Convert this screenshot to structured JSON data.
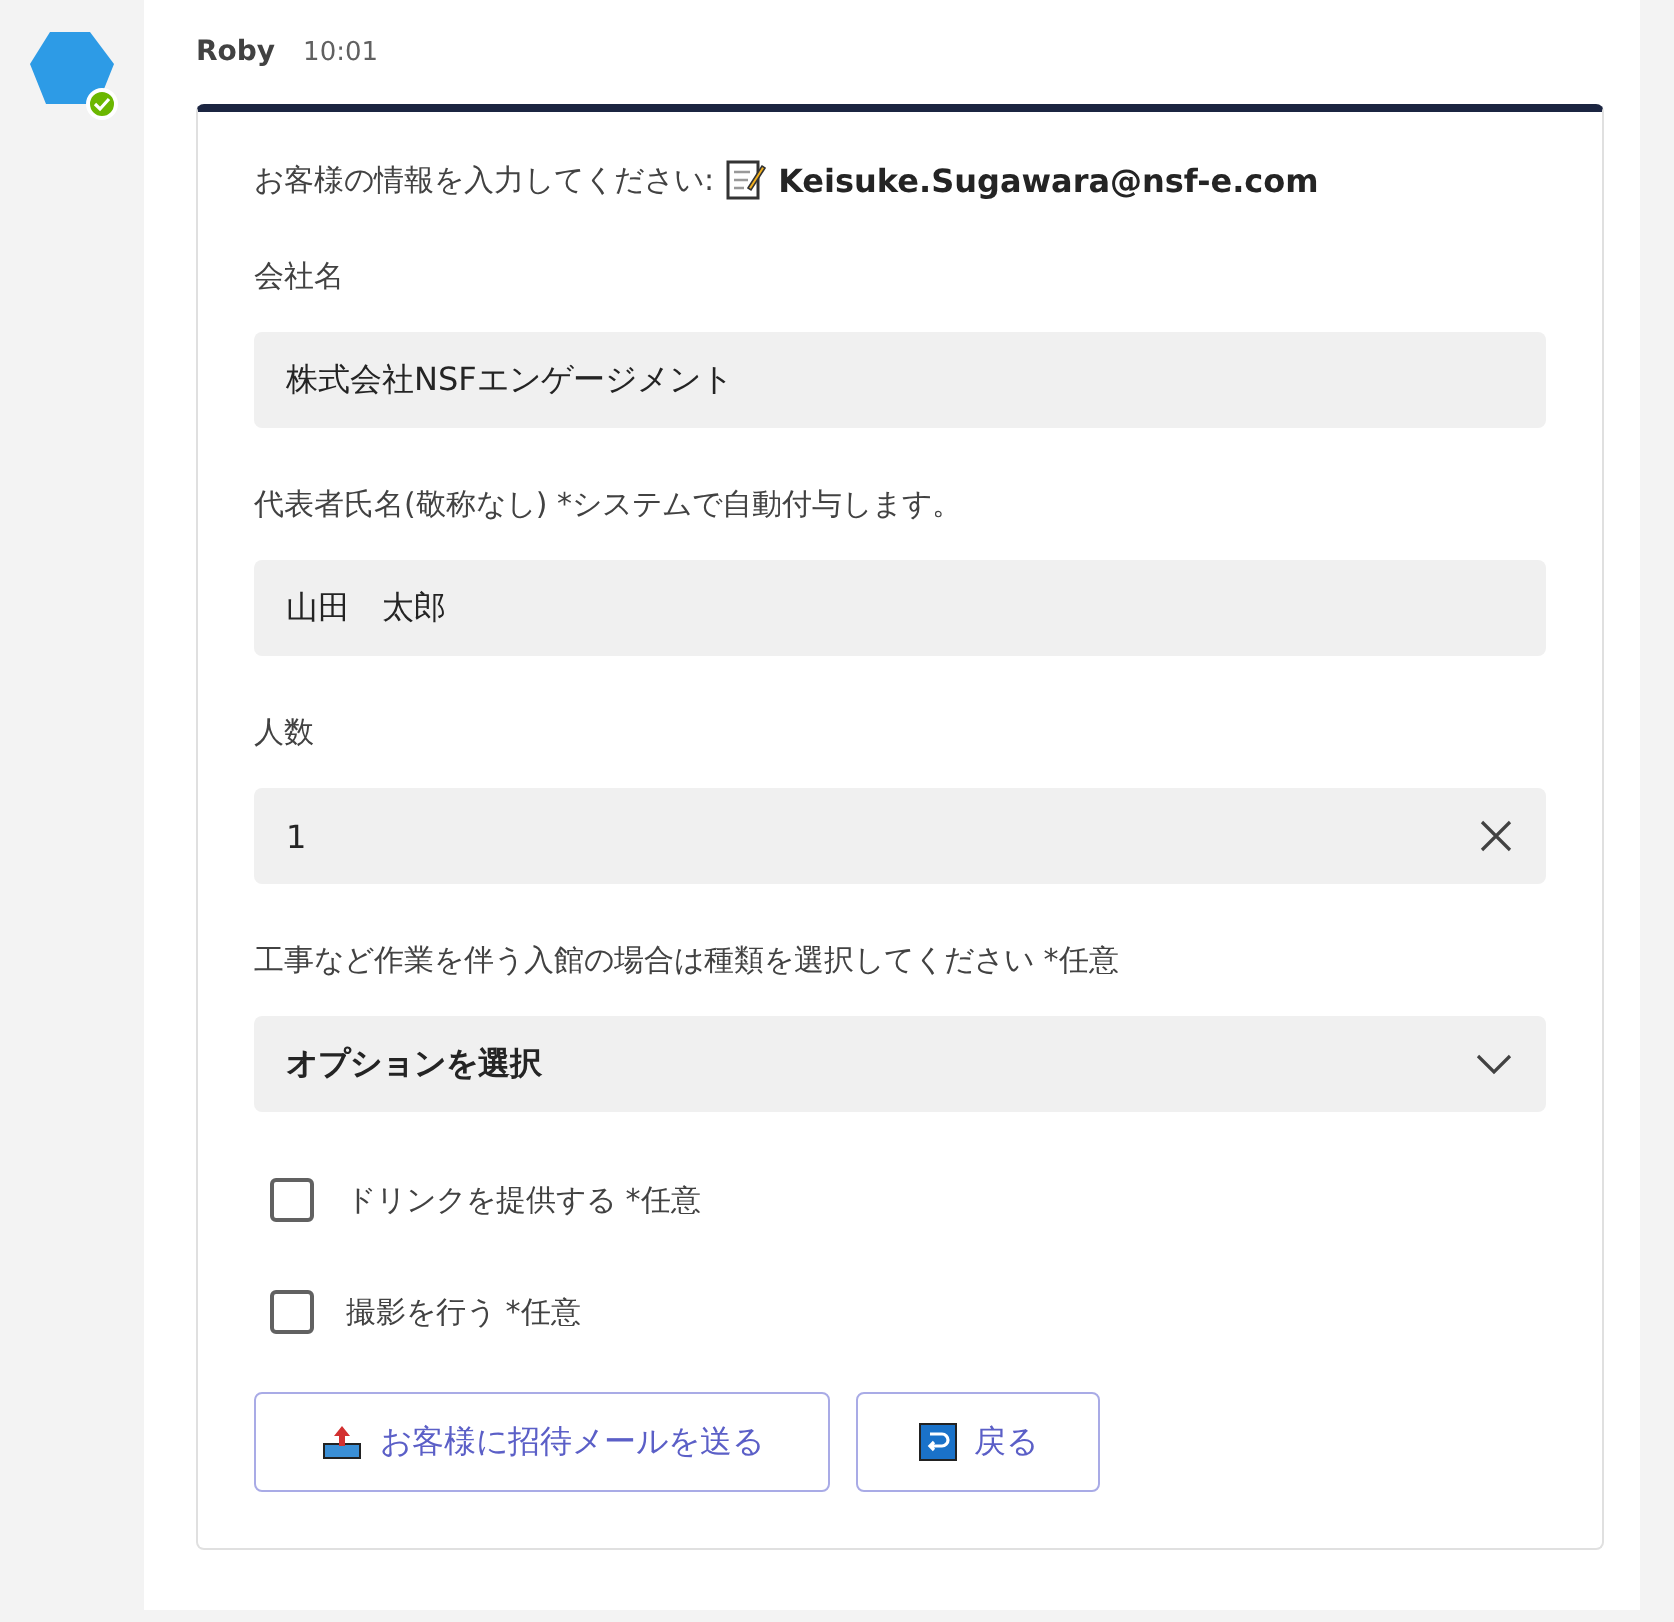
{
  "message": {
    "sender": "Roby",
    "time": "10:01"
  },
  "card": {
    "prompt": "お客様の情報を入力してください:",
    "email": "Keisuke.Sugawara@nsf-e.com",
    "fields": [
      {
        "kind": "text",
        "label": "会社名",
        "value": "株式会社NSFエンゲージメント"
      },
      {
        "kind": "text",
        "label": "代表者氏名(敬称なし) *システムで自動付与します。",
        "value": "山田　太郎"
      },
      {
        "kind": "number",
        "label": "人数",
        "value": "1"
      },
      {
        "kind": "select",
        "label": "工事など作業を伴う入館の場合は種類を選択してください *任意",
        "placeholder": "オプションを選択"
      }
    ],
    "checkboxes": [
      {
        "label": "ドリンクを提供する *任意",
        "checked": false
      },
      {
        "label": "撮影を行う *任意",
        "checked": false
      }
    ],
    "buttons": [
      {
        "kind": "send",
        "label": "お客様に招待メールを送る"
      },
      {
        "kind": "back",
        "label": "戻る"
      }
    ]
  }
}
